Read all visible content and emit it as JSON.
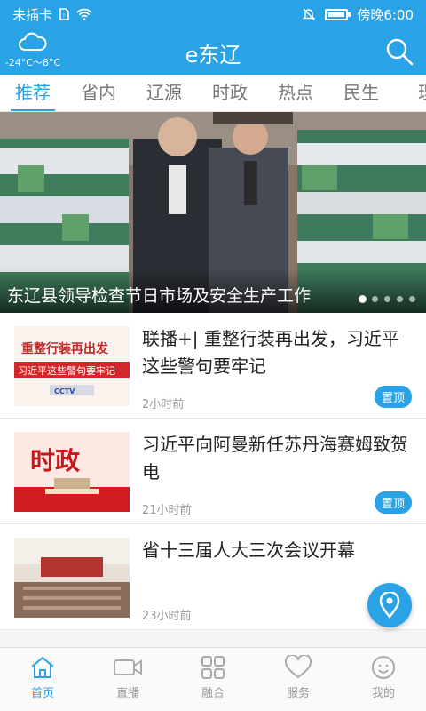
{
  "status": {
    "carrier": "未插卡",
    "time": "傍晚6:00"
  },
  "header": {
    "title": "e东辽",
    "weather_temp": "-24°C～8°C"
  },
  "tabs": [
    {
      "label": "推荐",
      "active": true
    },
    {
      "label": "省内"
    },
    {
      "label": "辽源"
    },
    {
      "label": "时政"
    },
    {
      "label": "热点"
    },
    {
      "label": "民生"
    },
    {
      "label": "理"
    }
  ],
  "banner": {
    "caption": "东辽县领导检查节日市场及安全生产工作",
    "slide_count": 5,
    "active_slide": 1
  },
  "news": [
    {
      "title": "联播+| 重整行装再出发，习近平这些警句要牢记",
      "time": "2小时前",
      "badge": "置顶",
      "thumb_text_1": "重整行装再出发",
      "thumb_text_2": "习近平这些警句要牢记",
      "thumb_logo": "CCTV"
    },
    {
      "title": "习近平向阿曼新任苏丹海赛姆致贺电",
      "time": "21小时前",
      "badge": "置顶",
      "thumb_text_1": "时政"
    },
    {
      "title": "省十三届人大三次会议开幕",
      "time": "23小时前"
    }
  ],
  "nav": [
    {
      "label": "首页",
      "icon": "home-icon",
      "active": true
    },
    {
      "label": "直播",
      "icon": "video-camera-icon"
    },
    {
      "label": "融合",
      "icon": "grid-icon"
    },
    {
      "label": "服务",
      "icon": "heart-icon"
    },
    {
      "label": "我的",
      "icon": "smiley-face-icon"
    }
  ],
  "colors": {
    "accent": "#2aa2e6"
  }
}
